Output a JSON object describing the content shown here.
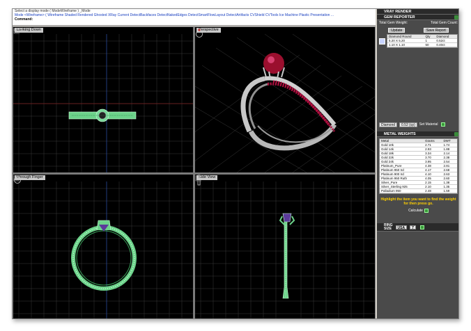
{
  "command_bar": {
    "prompt": "Select a display mode ( ModeWireframe ) _Mode",
    "options": "Mode <Wireframe> ( Wireframe  Shaded  Rendered  Ghosted  XRay  Current  DetectBackfaces  DetectNakedEdges  DetectSmartFlowLayout  DetectArtifacts  CVShield  CVTools  Ice  Machine  Plastic  Presentation  ...",
    "command_label": "Command:"
  },
  "viewports": {
    "top_left": {
      "title": "Looking Down"
    },
    "top_right": {
      "title": "Perspective"
    },
    "bottom_left": {
      "title": "Through Finger"
    },
    "bottom_right": {
      "title": "Side View"
    }
  },
  "panel": {
    "vray_header": "VRAY RENDER",
    "gem_header": "GEM REPORTER",
    "total_weight_label": "Total Gem Weight:",
    "total_count_label": "Total Gem Count:",
    "update_label": "Update",
    "save_report_label": "Save Report",
    "gem_table": {
      "headers": [
        "Diamond Round",
        "Qty",
        "Diamond"
      ],
      "rows": [
        [
          "5.20 X 5.20",
          "1",
          "0.52ct"
        ],
        [
          "1.10 X 1.10",
          "50",
          "0.40ct"
        ]
      ]
    },
    "material_select": "Diamond",
    "material_weight": "0.52 (cp)",
    "set_material_label": "Set Material",
    "metal_header": "METAL WEIGHTS",
    "metal_table": {
      "headers": [
        "Metal",
        "Grams",
        "DWT"
      ],
      "rows": [
        [
          "Gold 10k",
          "2.71",
          "1.74"
        ],
        [
          "Gold 14k",
          "2.93",
          "1.88"
        ],
        [
          "Gold 18k",
          "3.34",
          "2.14"
        ],
        [
          "Gold 22k",
          "3.70",
          "2.38"
        ],
        [
          "Gold 24k",
          "3.95",
          "2.54"
        ],
        [
          "Platinum_Pure",
          "4.38",
          "2.81"
        ],
        [
          "Platinum 950 Ird",
          "4.17",
          "2.68"
        ],
        [
          "Platinum 900 Ird",
          "4.10",
          "2.63"
        ],
        [
          "Platinum 950 Ruth",
          "4.05",
          "2.60"
        ],
        [
          "Silver_Pure",
          "2.15",
          "1.38"
        ],
        [
          "Silver_Sterling 925",
          "2.10",
          "1.35"
        ],
        [
          "Palladium 950",
          "2.48",
          "1.59"
        ]
      ]
    },
    "highlight_text": "Highlight the item you want to find the weight for then press go.",
    "calculate_label": "Calculate",
    "ring_header": "RING",
    "size_label": "SIZE",
    "region_select": "USA",
    "size_value": "7"
  }
}
